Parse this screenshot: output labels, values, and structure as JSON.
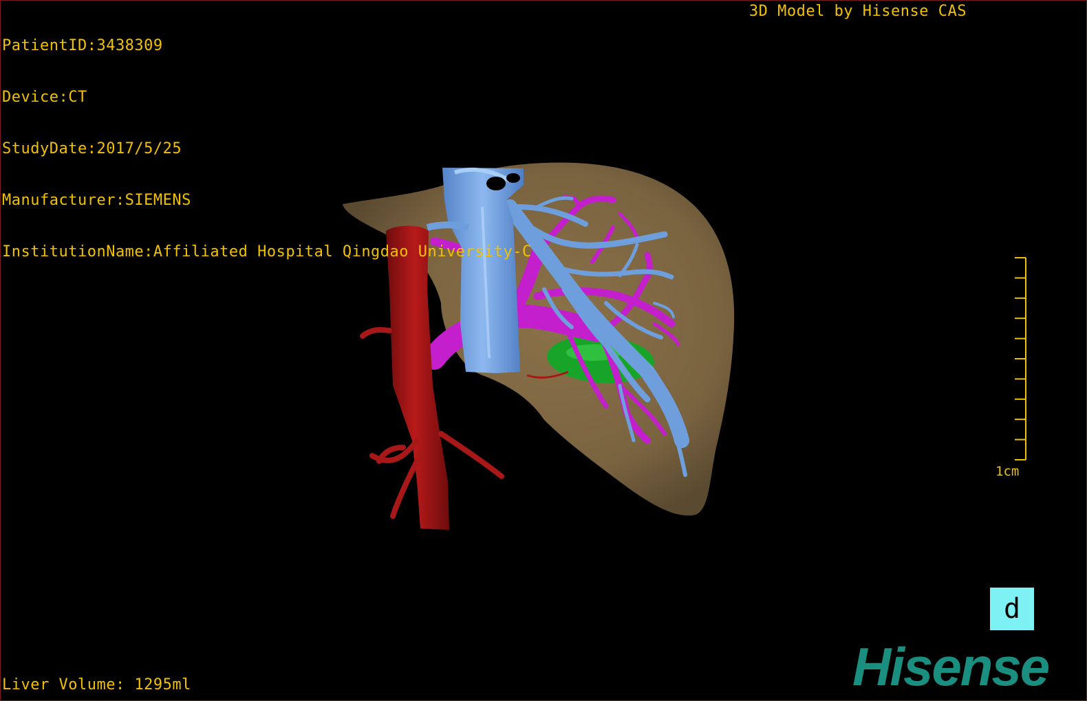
{
  "header": {
    "patient_id": "PatientID:3438309",
    "device": "Device:CT",
    "study_date": "StudyDate:2017/5/25",
    "manufacturer": "Manufacturer:SIEMENS",
    "institution": "InstitutionName:Affiliated Hospital Qingdao University-C",
    "model_credit": "3D Model by Hisense CAS"
  },
  "footer": {
    "liver_volume": "Liver Volume: 1295ml"
  },
  "scale_bar": {
    "label": "1cm",
    "ticks": 10
  },
  "orientation_cube": {
    "label": "d"
  },
  "branding": {
    "logo_text": "Hisense"
  },
  "colors": {
    "overlay_text": "#f2c200",
    "liver": "#7d6642",
    "aorta": "#a01414",
    "portal_vein": "#c020c8",
    "hepatic_vein": "#6a9ee0",
    "lesion": "#1bb02b",
    "orientation_cube": "#7ef1f5",
    "logo": "#1a8f80"
  }
}
